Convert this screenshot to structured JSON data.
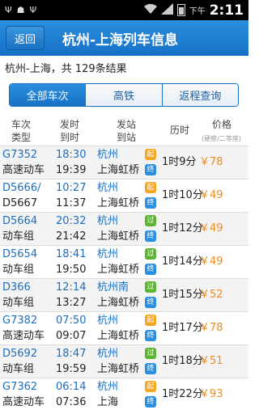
{
  "statusbar": {
    "ampm": "下午",
    "time": "2:11"
  },
  "header": {
    "back_label": "返回",
    "title": "杭州-上海列车信息"
  },
  "summary": "杭州-上海，共 129条结果",
  "tabs": [
    {
      "label": "全部车次",
      "active": true
    },
    {
      "label": "高铁",
      "active": false
    },
    {
      "label": "返程查询",
      "active": false
    }
  ],
  "columns": {
    "train": [
      "车次",
      "类型"
    ],
    "time": [
      "发站",
      "到站"
    ],
    "time_label": [
      "发时",
      "到时"
    ],
    "station": [
      "发站",
      "到站"
    ],
    "duration": "历时",
    "price": "价格",
    "price_note": "(硬座/二等座)"
  },
  "badge_colors": {
    "起": "#f5a623",
    "终": "#2a8fe0",
    "过": "#5cb531"
  },
  "rows": [
    {
      "no": "G7352",
      "type": "高速动车",
      "dep": "18:30",
      "arr": "19:39",
      "from": "杭州",
      "to": "上海虹桥",
      "from_badge": "起",
      "to_badge": "终",
      "duration": "1时9分",
      "price": "￥78"
    },
    {
      "no": "D5666/",
      "type": "D5667",
      "dep": "10:27",
      "arr": "11:37",
      "from": "杭州",
      "to": "上海虹桥",
      "from_badge": "起",
      "to_badge": "终",
      "duration": "1时10分",
      "price": "￥49"
    },
    {
      "no": "D5664",
      "type": "动车组",
      "dep": "20:32",
      "arr": "21:42",
      "from": "杭州",
      "to": "上海虹桥",
      "from_badge": "过",
      "to_badge": "终",
      "duration": "1时12分",
      "price": "￥49"
    },
    {
      "no": "D5654",
      "type": "动车组",
      "dep": "18:41",
      "arr": "19:50",
      "from": "杭州",
      "to": "上海虹桥",
      "from_badge": "过",
      "to_badge": "终",
      "duration": "1时14分",
      "price": "￥49"
    },
    {
      "no": "D366",
      "type": "动车组",
      "dep": "12:14",
      "arr": "13:27",
      "from": "杭州南",
      "to": "上海虹桥",
      "from_badge": "过",
      "to_badge": "终",
      "duration": "1时15分",
      "price": "￥52"
    },
    {
      "no": "G7382",
      "type": "高速动车",
      "dep": "07:50",
      "arr": "09:07",
      "from": "杭州",
      "to": "上海虹桥",
      "from_badge": "起",
      "to_badge": "终",
      "duration": "1时17分",
      "price": "￥78"
    },
    {
      "no": "D5692",
      "type": "动车组",
      "dep": "18:47",
      "arr": "19:59",
      "from": "杭州",
      "to": "上海虹桥",
      "from_badge": "过",
      "to_badge": "终",
      "duration": "1时18分",
      "price": "￥51"
    },
    {
      "no": "G7362",
      "type": "高速动车",
      "dep": "06:14",
      "arr": "07:36",
      "from": "杭州",
      "to": "上海",
      "from_badge": "起",
      "to_badge": "终",
      "duration": "1时22分",
      "price": "￥93"
    }
  ]
}
